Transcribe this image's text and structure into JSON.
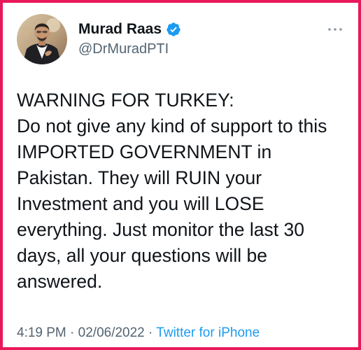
{
  "author": {
    "display_name": "Murad Raas",
    "handle": "@DrMuradPTI",
    "verified": true,
    "avatar": "profile-photo"
  },
  "tweet": {
    "text": "WARNING FOR TURKEY:\nDo not give any kind of support to this IMPORTED GOVERNMENT in Pakistan. They will RUIN your Investment and you will LOSE everything. Just monitor the last 30 days, all your questions will be answered.",
    "time": "4:19 PM",
    "separator_1": " · ",
    "date": "02/06/2022",
    "separator_2": " · ",
    "source": "Twitter for iPhone"
  },
  "icons": {
    "verified": "verified-badge-icon",
    "more": "more-options-icon"
  },
  "colors": {
    "border": "#e8195a",
    "text": "#0f1419",
    "secondary": "#536471",
    "link": "#1d9bf0"
  }
}
